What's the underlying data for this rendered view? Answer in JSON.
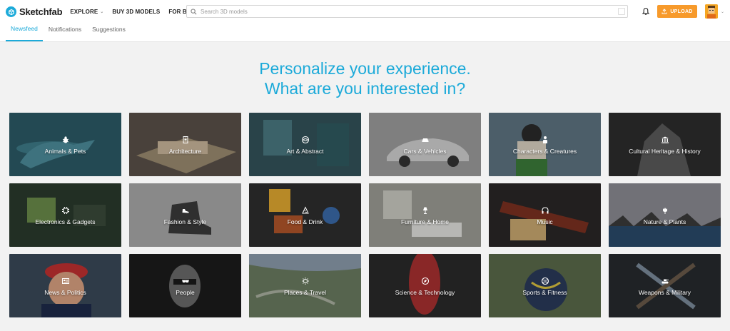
{
  "brand": {
    "name": "Sketchfab"
  },
  "nav": [
    {
      "label": "EXPLORE",
      "has_menu": true
    },
    {
      "label": "BUY 3D MODELS",
      "has_menu": false
    },
    {
      "label": "FOR BUSINESS",
      "has_menu": true
    }
  ],
  "search": {
    "placeholder": "Search 3D models",
    "value": ""
  },
  "header": {
    "upload_label": "UPLOAD"
  },
  "tabs": [
    {
      "label": "Newsfeed",
      "active": true
    },
    {
      "label": "Notifications",
      "active": false
    },
    {
      "label": "Suggestions",
      "active": false
    }
  ],
  "heading": {
    "line1": "Personalize your experience.",
    "line2": "What are you interested in?"
  },
  "categories": [
    {
      "label": "Animals & Pets",
      "icon": "bug-icon",
      "bg": "#2b5a66"
    },
    {
      "label": "Architecture",
      "icon": "building-icon",
      "bg": "#5a5048"
    },
    {
      "label": "Art & Abstract",
      "icon": "swirl-icon",
      "bg": "#33525a"
    },
    {
      "label": "Cars & Vehicles",
      "icon": "car-icon",
      "bg": "#8a8a8a"
    },
    {
      "label": "Characters & Creatures",
      "icon": "person-icon",
      "bg": "#5d7380"
    },
    {
      "label": "Cultural Heritage & History",
      "icon": "museum-icon",
      "bg": "#2c2c2c"
    },
    {
      "label": "Electronics & Gadgets",
      "icon": "chip-icon",
      "bg": "#2a3a2c"
    },
    {
      "label": "Fashion & Style",
      "icon": "shoe-icon",
      "bg": "#9a9a9a"
    },
    {
      "label": "Food & Drink",
      "icon": "pizza-icon",
      "bg": "#2e2e2e"
    },
    {
      "label": "Furniture & Home",
      "icon": "lamp-icon",
      "bg": "#8c8c86"
    },
    {
      "label": "Music",
      "icon": "headphones-icon",
      "bg": "#2a2626"
    },
    {
      "label": "Nature & Plants",
      "icon": "flower-icon",
      "bg": "#6a6a70"
    },
    {
      "label": "News & Politics",
      "icon": "newspaper-icon",
      "bg": "#3a4858"
    },
    {
      "label": "People",
      "icon": "sunglasses-icon",
      "bg": "#1c1c1c"
    },
    {
      "label": "Places & Travel",
      "icon": "sun-icon",
      "bg": "#5a6a58"
    },
    {
      "label": "Science & Technology",
      "icon": "compass-icon",
      "bg": "#2a2a2a"
    },
    {
      "label": "Sports & Fitness",
      "icon": "ball-icon",
      "bg": "#4a5a40"
    },
    {
      "label": "Weapons & Military",
      "icon": "tank-icon",
      "bg": "#262a2e"
    }
  ]
}
